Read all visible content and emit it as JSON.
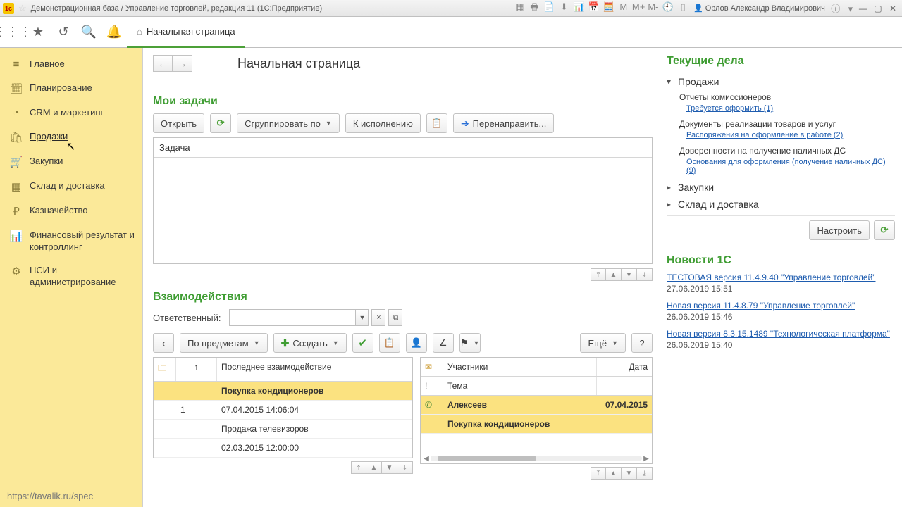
{
  "window": {
    "title": "Демонстрационная база / Управление торговлей, редакция 11 (1С:Предприятие)",
    "logo_text": "1c",
    "user": "Орлов Александр Владимирович"
  },
  "toolbar": {
    "tab": "Начальная страница"
  },
  "sidebar": {
    "items": [
      {
        "icon": "≡",
        "label": "Главное"
      },
      {
        "icon": "🗓",
        "label": "Планирование"
      },
      {
        "icon": "◔",
        "label": "CRM и маркетинг"
      },
      {
        "icon": "🛍",
        "label": "Продажи"
      },
      {
        "icon": "🛒",
        "label": "Закупки"
      },
      {
        "icon": "▦",
        "label": "Склад и доставка"
      },
      {
        "icon": "₽",
        "label": "Казначейство"
      },
      {
        "icon": "📊",
        "label": "Финансовый результат и контроллинг"
      },
      {
        "icon": "⚙",
        "label": "НСИ и администрирование"
      }
    ],
    "status_url": "https://tavalik.ru/spec"
  },
  "page": {
    "title": "Начальная страница"
  },
  "tasks": {
    "title": "Мои задачи",
    "open": "Открыть",
    "group": "Сгруппировать по",
    "due": "К исполнению",
    "redirect": "Перенаправить...",
    "column": "Задача"
  },
  "interactions": {
    "title": "Взаимодействия",
    "responsible_label": "Ответственный:",
    "by_subject": "По предметам",
    "create": "Создать",
    "more": "Ещё",
    "help": "?",
    "left_table": {
      "col_last": "Последнее взаимодействие",
      "arrow": "↑",
      "rows": [
        {
          "group": "Покупка кондиционеров"
        },
        {
          "num": "1",
          "date": "07.04.2015 14:06:04"
        },
        {
          "group_plain": "Продажа телевизоров"
        },
        {
          "num": "",
          "date": "02.03.2015 12:00:00"
        }
      ]
    },
    "right_table": {
      "col_participants": "Участники",
      "col_date": "Дата",
      "col_topic": "Тема",
      "rows": [
        {
          "name": "Алексеев",
          "date": "07.04.2015"
        },
        {
          "topic": "Покупка кондиционеров"
        }
      ]
    }
  },
  "affairs": {
    "title": "Текущие дела",
    "sales": "Продажи",
    "a1": "Отчеты комиссионеров",
    "a1_link": "Требуется оформить (1)",
    "a2": "Документы реализации товаров и услуг",
    "a2_link": "Распоряжения на оформление в работе (2)",
    "a3": "Доверенности на получение наличных ДС",
    "a3_link": "Основания для оформления (получение наличных ДС) (9)",
    "purchases": "Закупки",
    "warehouse": "Склад и доставка",
    "configure": "Настроить"
  },
  "news": {
    "title": "Новости 1С",
    "items": [
      {
        "link": "ТЕСТОВАЯ версия 11.4.9.40 \"Управление торговлей\"",
        "date": "27.06.2019 15:51"
      },
      {
        "link": "Новая версия 11.4.8.79 \"Управление торговлей\"",
        "date": "26.06.2019 15:46"
      },
      {
        "link": "Новая версия 8.3.15.1489 \"Технологическая платформа\"",
        "date": "26.06.2019 15:40"
      }
    ]
  }
}
